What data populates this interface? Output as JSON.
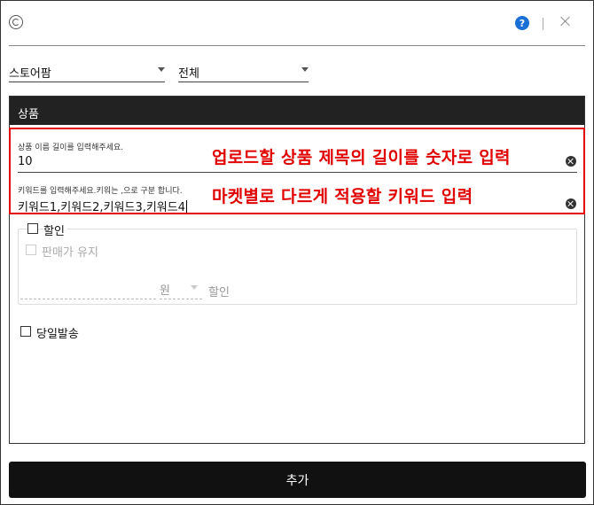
{
  "titlebar": {
    "help_icon": "question-circle-icon",
    "help_text": "?",
    "close_icon": "close-icon"
  },
  "filters": {
    "store": {
      "value": "스토어팜"
    },
    "scope": {
      "value": "전체"
    }
  },
  "panel": {
    "header": "상품",
    "title_length": {
      "label": "상품 이름 길이를 입력해주세요.",
      "value": "10",
      "annotation": "업로드할 상품 제목의 길이를 숫자로 입력"
    },
    "keywords": {
      "label": "키워드를 입력해주세요.키워는 ,으로 구분 합니다.",
      "value": "키워드1,키워드2,키워드3,키워드4",
      "annotation": "마켓별로 다르게 적용할 키워드 입력"
    },
    "discount": {
      "label": "할인",
      "keep_price_label": "판매가 유지",
      "unit": "원",
      "suffix": "할인"
    },
    "same_day": {
      "label": "당일발송"
    }
  },
  "footer": {
    "add_label": "추가"
  },
  "colors": {
    "header_bg": "#222222",
    "annotation": "#e00000",
    "help": "#1a6fd6",
    "button_bg": "#111111"
  }
}
